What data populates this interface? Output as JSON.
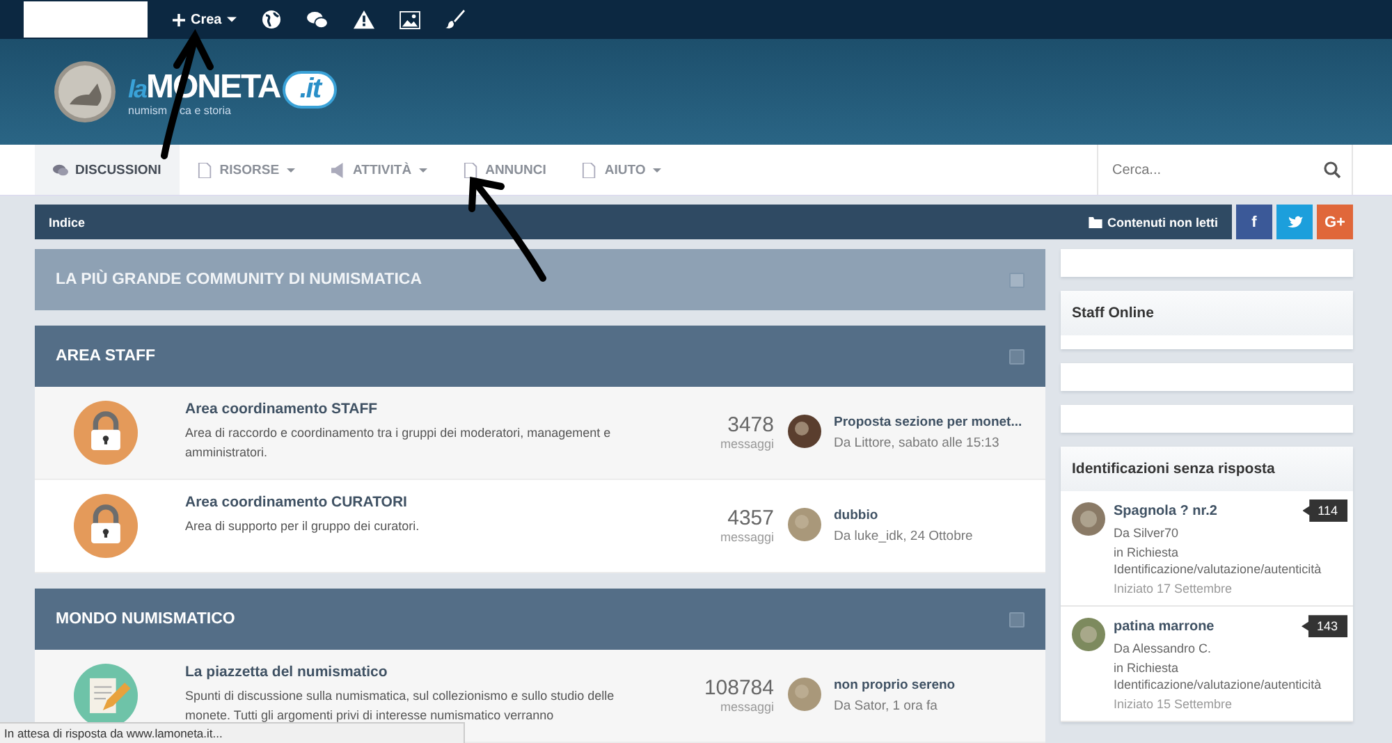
{
  "topbar": {
    "create_label": "Crea"
  },
  "header": {
    "logo_prefix": "la",
    "logo_name": "MONETA",
    "logo_suffix": ".it",
    "tagline_parts": [
      "numism",
      "ca e storia"
    ]
  },
  "nav": {
    "items": [
      {
        "label": "DISCUSSIONI",
        "selected": true,
        "has_menu": false
      },
      {
        "label": "RISORSE",
        "selected": false,
        "has_menu": true
      },
      {
        "label": "ATTIVITÀ",
        "selected": false,
        "has_menu": true
      },
      {
        "label": "ANNUNCI",
        "selected": false,
        "has_menu": false
      },
      {
        "label": "AIUTO",
        "selected": false,
        "has_menu": true
      }
    ],
    "search": {
      "placeholder": "Cerca..."
    }
  },
  "breadcrumb": {
    "items": [
      "Indice"
    ],
    "unread": "Contenuti non letti"
  },
  "social": [
    {
      "kind": "facebook",
      "label": "f"
    },
    {
      "kind": "twitter"
    },
    {
      "kind": "google",
      "label": "G+"
    }
  ],
  "categories": [
    {
      "kind": "banner",
      "title": "LA PIÙ GRANDE COMMUNITY DI NUMISMATICA"
    },
    {
      "kind": "category",
      "title": "AREA STAFF",
      "forums": [
        {
          "locked": true,
          "title": "Area coordinamento STAFF",
          "description": "Area di raccordo e coordinamento tra i gruppi dei moderatori, management e amministratori.",
          "count": "3478",
          "count_label": "messaggi",
          "last_title": "Proposta sezione per monet...",
          "last_meta": "Da Littore, sabato alle 15:13"
        },
        {
          "locked": true,
          "title": "Area coordinamento CURATORI",
          "description": "Area di supporto per il gruppo dei curatori.",
          "count": "4357",
          "count_label": "messaggi",
          "last_title": "dubbio",
          "last_meta": "Da luke_idk, 24 Ottobre"
        }
      ]
    },
    {
      "kind": "category",
      "title": "MONDO NUMISMATICO",
      "forums": [
        {
          "locked": false,
          "title": "La piazzetta del numismatico",
          "description": "Spunti di discussione sulla numismatica, sul collezionismo e sullo studio delle monete. Tutti gli argomenti privi di interesse numismatico verranno",
          "count": "108784",
          "count_label": "messaggi",
          "last_title": "non proprio sereno",
          "last_meta": "Da Sator, 1 ora fa"
        }
      ]
    }
  ],
  "sidebar": [
    {
      "kind": "empty"
    },
    {
      "kind": "titled",
      "title": "Staff Online"
    },
    {
      "kind": "empty"
    },
    {
      "kind": "empty"
    },
    {
      "kind": "topics",
      "title": "Identificazioni senza risposta",
      "topics": [
        {
          "title": "Spagnola ? nr.2",
          "by": "Da Silver70",
          "forum": "in Richiesta Identificazione/valutazione/autenticità",
          "started": "Iniziato 17 Settembre",
          "count": "114"
        },
        {
          "title": "patina marrone",
          "by": "Da Alessandro C.",
          "forum": "in Richiesta Identificazione/valutazione/autenticità",
          "started": "Iniziato 15 Settembre",
          "count": "143"
        }
      ]
    }
  ],
  "status_bar": "In attesa di risposta da www.lamoneta.it..."
}
